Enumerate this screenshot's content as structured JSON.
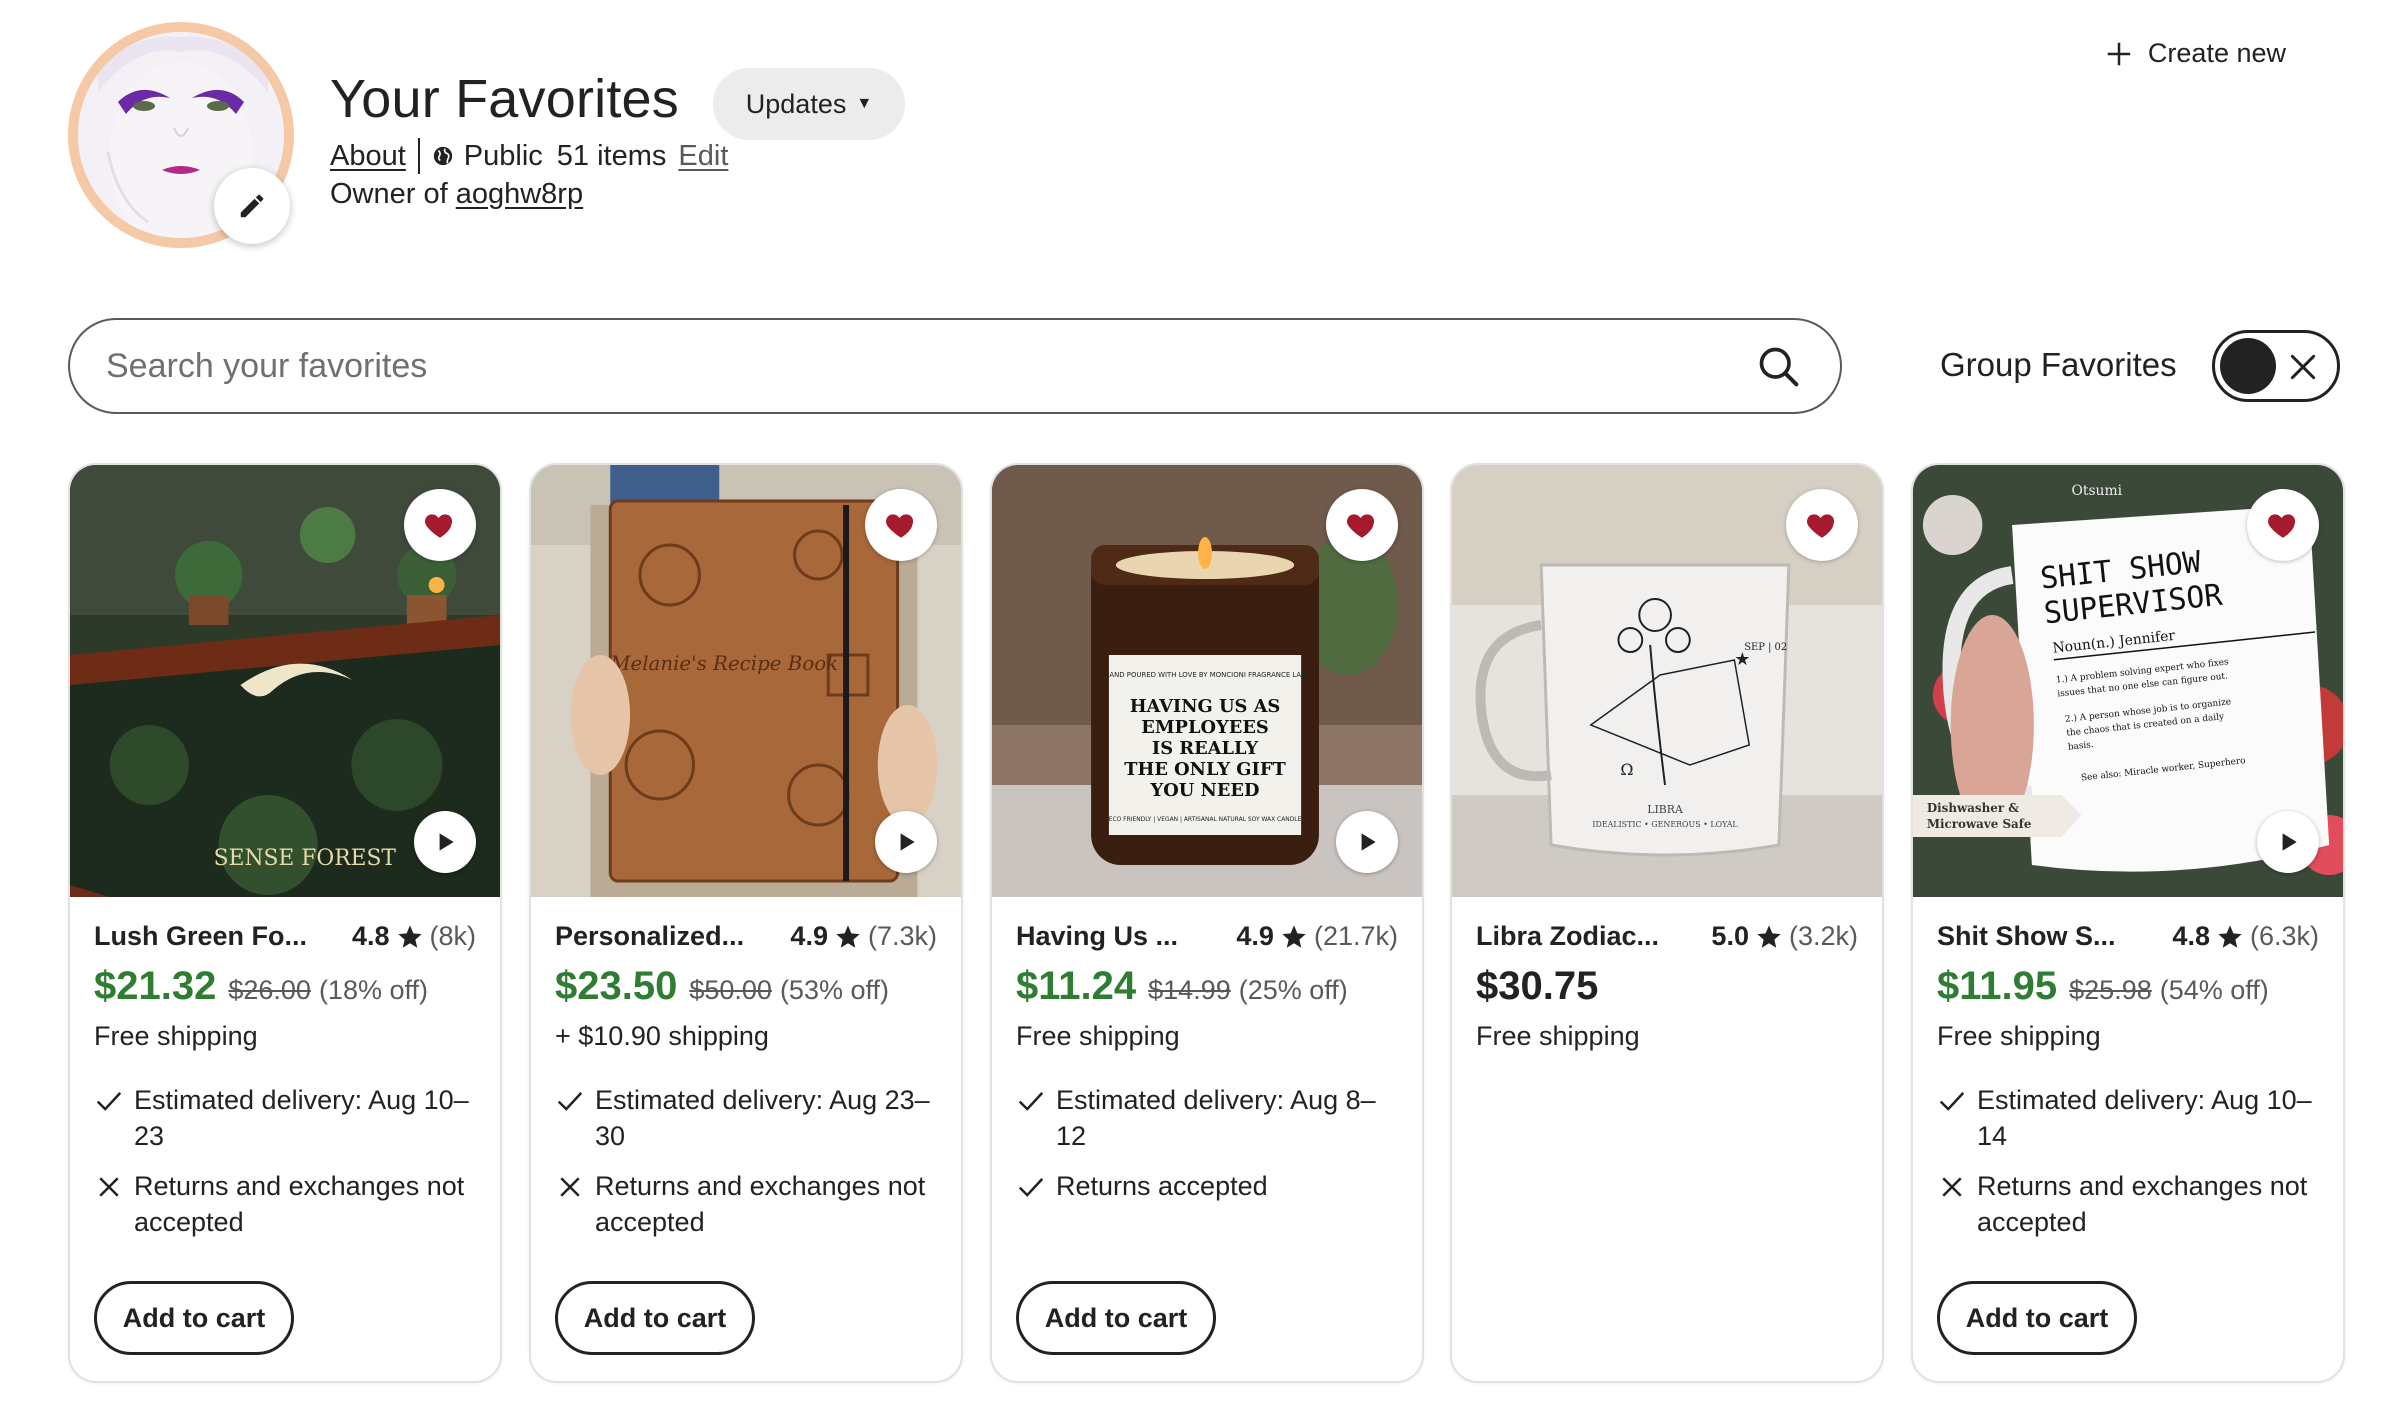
{
  "header": {
    "title": "Your Favorites",
    "updates_label": "Updates",
    "about_label": "About",
    "visibility": "Public",
    "item_count": "51 items",
    "edit_label": "Edit",
    "owner_prefix": "Owner of ",
    "owner_shop": "aoghw8rp",
    "create_new_label": "Create new"
  },
  "search": {
    "placeholder": "Search your favorites",
    "value": ""
  },
  "group_favorites": {
    "label": "Group Favorites",
    "enabled": false
  },
  "colors": {
    "price_green": "#2e7d32",
    "heart_red": "#a61a2e",
    "avatar_ring": "#f5c9a6"
  },
  "cards": [
    {
      "name": "Lush Green Fo...",
      "rating": "4.8",
      "reviews": "(8k)",
      "price": "$21.32",
      "original_price": "$26.00",
      "discount": "(18% off)",
      "shipping": "Free shipping",
      "delivery": "Estimated delivery: Aug 10–23",
      "returns": "Returns and exchanges not accepted",
      "image_text": "SENSE FOREST",
      "cart_label": "Add to cart"
    },
    {
      "name": "Personalized...",
      "rating": "4.9",
      "reviews": "(7.3k)",
      "price": "$23.50",
      "original_price": "$50.00",
      "discount": "(53% off)",
      "shipping": "+ $10.90 shipping",
      "delivery": "Estimated delivery: Aug 23–30",
      "returns": "Returns and exchanges not accepted",
      "image_text": "Melanie's Recipe Book",
      "cart_label": "Add to cart"
    },
    {
      "name": "Having Us ...",
      "rating": "4.9",
      "reviews": "(21.7k)",
      "price": "$11.24",
      "original_price": "$14.99",
      "discount": "(25% off)",
      "shipping": "Free shipping",
      "delivery": "Estimated delivery: Aug 8–12",
      "returns": "Returns accepted",
      "image_text_top": "HAND POURED WITH LOVE BY MONCIONI FRAGRANCE LAB",
      "image_text_main": [
        "HAVING US AS",
        "EMPLOYEES",
        "IS REALLY",
        "THE ONLY GIFT",
        "YOU NEED"
      ],
      "image_text_bottom": "ECO FRIENDLY | VEGAN | ARTISANAL NATURAL SOY WAX CANDLE",
      "cart_label": "Add to cart"
    },
    {
      "name": "Libra Zodiac...",
      "rating": "5.0",
      "reviews": "(3.2k)",
      "price": "$30.75",
      "shipping": "Free shipping",
      "image_text_date": "SEP | 02",
      "image_text_sign": "LIBRA",
      "image_text_traits": "IDEALISTIC • GENEROUS • LOYAL",
      "image_text_symbol": "Ω"
    },
    {
      "name": "Shit Show S...",
      "rating": "4.8",
      "reviews": "(6.3k)",
      "price": "$11.95",
      "original_price": "$25.98",
      "discount": "(54% off)",
      "shipping": "Free shipping",
      "delivery": "Estimated delivery: Aug 10–14",
      "returns": "Returns and exchanges not accepted",
      "image_text_brand": "Otsumi",
      "image_text_title": [
        "SHIT SHOW",
        "SUPERVISOR"
      ],
      "image_text_name": "Noun(n.) Jennifer",
      "image_text_def1": [
        "1.) A problem solving expert who fixes",
        "issues that no one else can figure out."
      ],
      "image_text_def2": [
        "2.) A person whose job is to organize",
        "the chaos that is created on a daily",
        "basis."
      ],
      "image_text_see": "See also: Miracle worker, Superhero",
      "image_text_badge": [
        "Dishwasher &",
        "Microwave Safe"
      ],
      "cart_label": "Add to cart"
    }
  ]
}
